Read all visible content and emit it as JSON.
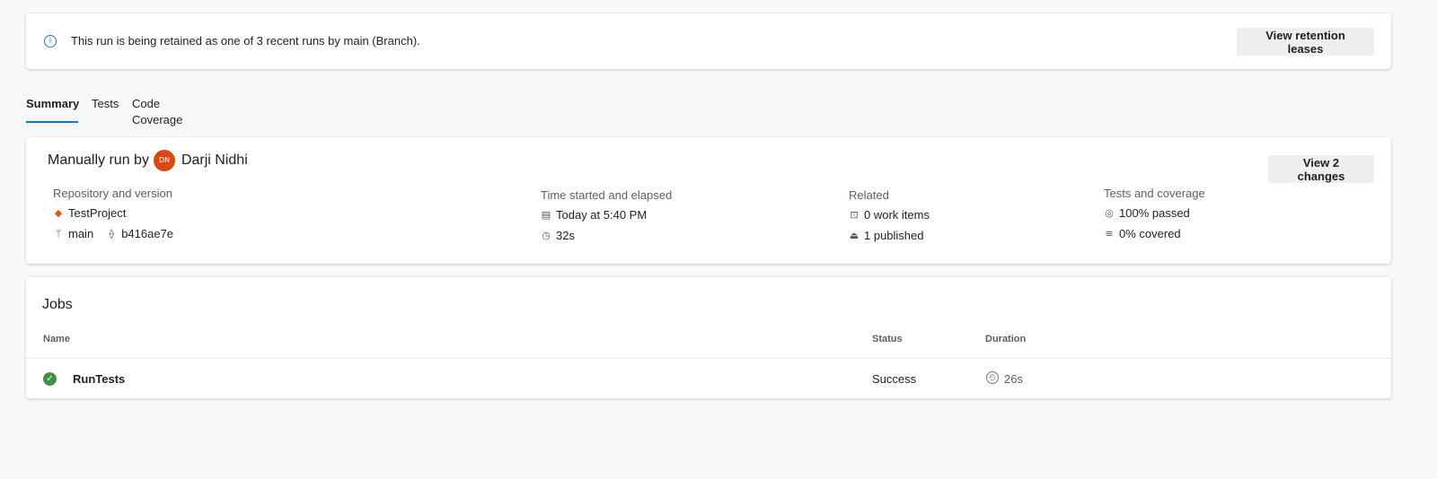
{
  "banner": {
    "message": "This run is being retained as one of 3 recent runs by main (Branch).",
    "button_label": "View retention leases"
  },
  "tabs": [
    {
      "label": "Summary",
      "active": true
    },
    {
      "label": "Tests",
      "active": false
    },
    {
      "label": "Code Coverage",
      "active": false
    }
  ],
  "summary": {
    "run_by_prefix": "Manually run by",
    "avatar_initials": "DN",
    "user_name": "Darji Nidhi",
    "changes_button_label": "View 2 changes",
    "repository": {
      "heading": "Repository and version",
      "repo_name": "TestProject",
      "branch": "main",
      "commit": "b416ae7e"
    },
    "time": {
      "heading": "Time started and elapsed",
      "started": "Today at 5:40 PM",
      "elapsed": "32s"
    },
    "related": {
      "heading": "Related",
      "work_items": "0 work items",
      "published": "1 published"
    },
    "tests": {
      "heading": "Tests and coverage",
      "passed": "100% passed",
      "covered": "0% covered"
    }
  },
  "jobs": {
    "heading": "Jobs",
    "columns": {
      "name": "Name",
      "status": "Status",
      "duration": "Duration"
    },
    "rows": [
      {
        "name": "RunTests",
        "status": "Success",
        "duration": "26s"
      }
    ]
  },
  "colors": {
    "accent": "#0078d4",
    "success": "#3f9142",
    "avatar": "#d9480f",
    "info": "#1f7abf"
  }
}
